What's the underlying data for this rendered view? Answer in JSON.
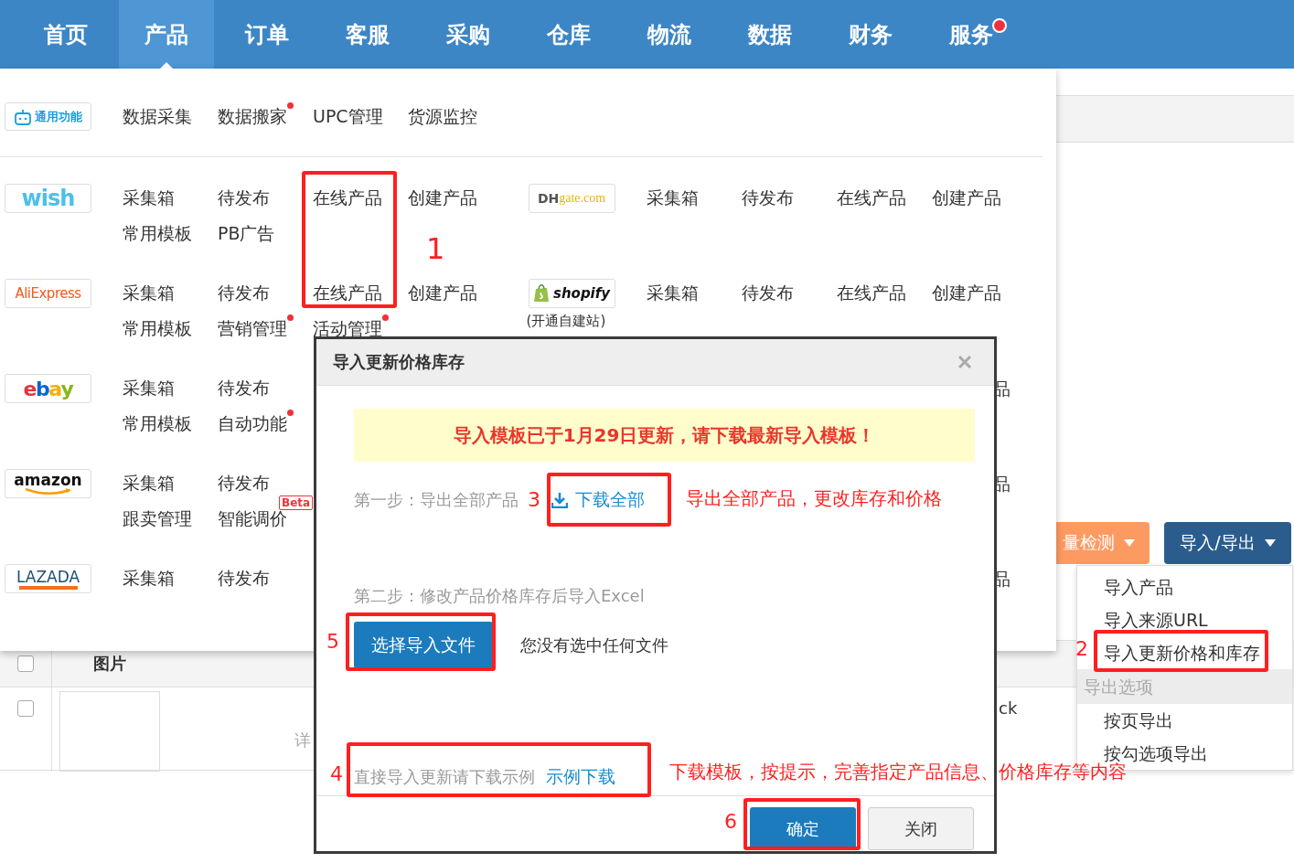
{
  "nav": [
    {
      "label": "首页",
      "selected": false,
      "dot": false
    },
    {
      "label": "产品",
      "selected": true,
      "dot": false
    },
    {
      "label": "订单",
      "selected": false,
      "dot": false
    },
    {
      "label": "客服",
      "selected": false,
      "dot": false
    },
    {
      "label": "采购",
      "selected": false,
      "dot": false
    },
    {
      "label": "仓库",
      "selected": false,
      "dot": false
    },
    {
      "label": "物流",
      "selected": false,
      "dot": false
    },
    {
      "label": "数据",
      "selected": false,
      "dot": false
    },
    {
      "label": "财务",
      "selected": false,
      "dot": false
    },
    {
      "label": "服务",
      "selected": false,
      "dot": true
    }
  ],
  "menu": {
    "general": {
      "badge": "通用功能",
      "items": [
        {
          "label": "数据采集",
          "dot": false
        },
        {
          "label": "数据搬家",
          "dot": true
        },
        {
          "label": "UPC管理",
          "dot": false
        },
        {
          "label": "货源监控",
          "dot": false
        }
      ]
    },
    "rows": [
      {
        "left": {
          "kind": "platform",
          "logo": {
            "kind": "wish",
            "text": "wish"
          },
          "lines": [
            [
              {
                "label": "采集箱",
                "dot": false
              },
              {
                "label": "待发布",
                "dot": false
              },
              {
                "label": "在线产品",
                "dot": false
              },
              {
                "label": "创建产品",
                "dot": false
              }
            ],
            [
              {
                "label": "常用模板",
                "dot": false
              },
              {
                "label": "PB广告",
                "dot": false
              }
            ]
          ]
        },
        "right": {
          "kind": "platform",
          "logo": {
            "kind": "dhgate",
            "text": "DHgate.com"
          },
          "lines": [
            [
              {
                "label": "采集箱",
                "dot": false
              },
              {
                "label": "待发布",
                "dot": false
              },
              {
                "label": "在线产品",
                "dot": false
              },
              {
                "label": "创建产品",
                "dot": false
              }
            ]
          ]
        }
      },
      {
        "left": {
          "kind": "platform",
          "logo": {
            "kind": "aliexpress",
            "text": "AliExpress"
          },
          "lines": [
            [
              {
                "label": "采集箱",
                "dot": false
              },
              {
                "label": "待发布",
                "dot": false
              },
              {
                "label": "在线产品",
                "dot": false
              },
              {
                "label": "创建产品",
                "dot": false
              }
            ],
            [
              {
                "label": "常用模板",
                "dot": false
              },
              {
                "label": "营销管理",
                "dot": true
              },
              {
                "label": "活动管理",
                "dot": true
              }
            ]
          ]
        },
        "right": {
          "kind": "platform",
          "logo": {
            "kind": "shopify",
            "text": "shopify"
          },
          "note": "(开通自建站)",
          "lines": [
            [
              {
                "label": "采集箱",
                "dot": false
              },
              {
                "label": "待发布",
                "dot": false
              },
              {
                "label": "在线产品",
                "dot": false
              },
              {
                "label": "创建产品",
                "dot": false
              }
            ]
          ]
        }
      },
      {
        "left": {
          "kind": "platform",
          "logo": {
            "kind": "ebay",
            "text": "ebay"
          },
          "lines": [
            [
              {
                "label": "采集箱",
                "dot": false
              },
              {
                "label": "待发布",
                "dot": false
              }
            ],
            [
              {
                "label": "常用模板",
                "dot": false
              },
              {
                "label": "自动功能",
                "dot": true
              }
            ]
          ]
        },
        "right": {
          "kind": "covered",
          "text": "品"
        }
      },
      {
        "left": {
          "kind": "platform",
          "logo": {
            "kind": "amazon",
            "text": "amazon"
          },
          "lines": [
            [
              {
                "label": "采集箱",
                "dot": false
              },
              {
                "label": "待发布",
                "dot": false
              }
            ],
            [
              {
                "label": "跟卖管理",
                "dot": false
              },
              {
                "label": "智能调价",
                "dot": false,
                "badge": "Beta"
              }
            ]
          ]
        },
        "right": {
          "kind": "covered",
          "text": "品"
        }
      },
      {
        "left": {
          "kind": "platform",
          "logo": {
            "kind": "lazada",
            "text": "LAZADA"
          },
          "lines": [
            [
              {
                "label": "采集箱",
                "dot": false
              },
              {
                "label": "待发布",
                "dot": false
              }
            ]
          ]
        },
        "right": {
          "kind": "covered",
          "text": "品"
        }
      }
    ]
  },
  "page": {
    "batch_button": "量检测",
    "io_button": "导入/导出",
    "io_menu": [
      {
        "kind": "item",
        "label": "导入产品"
      },
      {
        "kind": "item",
        "label": "导入来源URL"
      },
      {
        "kind": "item",
        "label": "导入更新价格和库存"
      },
      {
        "kind": "header",
        "label": "导出选项"
      },
      {
        "kind": "item",
        "label": "按页导出"
      },
      {
        "kind": "item",
        "label": "按勾选项导出"
      }
    ],
    "table": {
      "header": {
        "checked": false,
        "label": "图片"
      },
      "row": {
        "checked": false,
        "cell_1": "详",
        "cell_2": "ck"
      }
    }
  },
  "dialog": {
    "title": "导入更新价格库存",
    "notice": "导入模板已于1月29日更新，请下载最新导入模板！",
    "step1": {
      "label": "第一步：导出全部产品",
      "link": "下载全部"
    },
    "step2": {
      "label": "第二步：修改产品价格库存后导入Excel",
      "button": "选择导入文件",
      "status": "您没有选中任何文件"
    },
    "sample": {
      "label": "直接导入更新请下载示例",
      "link": "示例下载"
    },
    "buttons": [
      {
        "kind": "primary",
        "label": "确定"
      },
      {
        "kind": "default",
        "label": "关闭"
      }
    ]
  },
  "annotations": [
    {
      "number": "1"
    },
    {
      "number": "3",
      "note": "导出全部产品，更改库存和价格"
    },
    {
      "number": "5"
    },
    {
      "number": "2"
    },
    {
      "number": "4",
      "note": "下载模板，按提示，完善指定产品信息、价格库存等内容"
    },
    {
      "number": "6"
    }
  ]
}
